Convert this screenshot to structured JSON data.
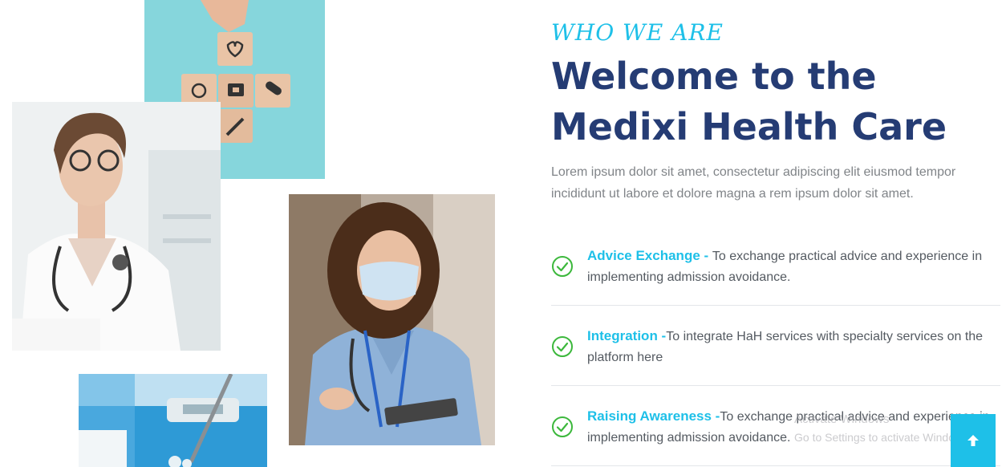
{
  "about": {
    "kicker": "WHO WE ARE",
    "heading": "Welcome to the Medixi Health Care",
    "intro": "Lorem ipsum dolor sit amet, consectetur adipiscing elit eiusmod tempor incididunt ut labore et dolore magna a rem ipsum dolor sit amet.",
    "features": [
      {
        "title": "Advice Exchange - ",
        "description": "To exchange practical advice and experience in implementing admission avoidance.",
        "icon": "check-circle-icon"
      },
      {
        "title": "Integration -",
        "description": "To integrate HaH services with specialty services on the platform here",
        "icon": "check-circle-icon"
      },
      {
        "title": "Raising Awareness -",
        "description": "To exchange practical advice and experience in implementing admission avoidance.",
        "icon": "check-circle-icon"
      }
    ]
  },
  "overlay": {
    "watermark_title": "Activate Windows",
    "watermark_sub": "Go to Settings to activate Windows.",
    "scroll_top_icon": "arrow-up-icon"
  },
  "colors": {
    "accent": "#1ec0e8",
    "heading": "#253c74",
    "check": "#3cb83c",
    "body_text": "#545a61"
  },
  "images": [
    {
      "name": "medical-blocks-photo",
      "description": "wooden blocks with medical icons on teal background"
    },
    {
      "name": "female-doctor-photo",
      "description": "smiling doctor with glasses and stethoscope"
    },
    {
      "name": "nurse-masked-photo",
      "description": "nurse in blue scrubs wearing face mask holding tablet"
    },
    {
      "name": "lab-equipment-photo",
      "description": "laboratory pipette and sample tubes on blue"
    }
  ]
}
